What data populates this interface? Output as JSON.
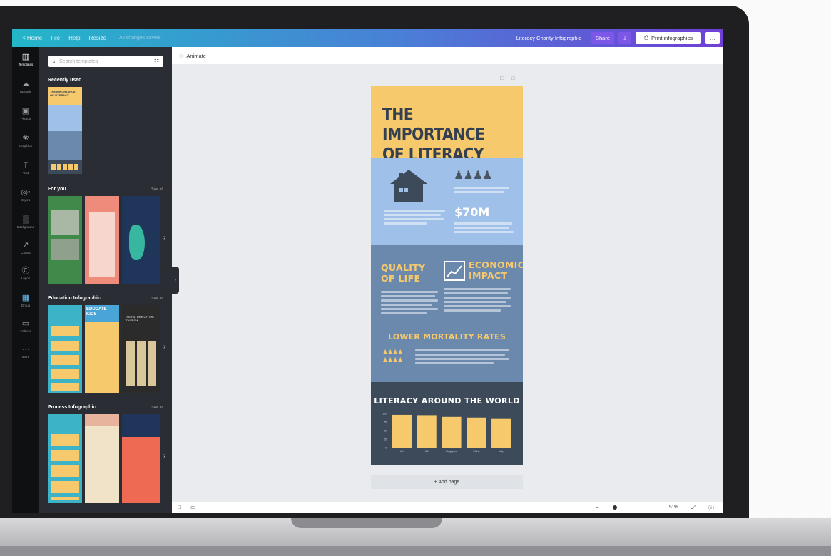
{
  "topbar": {
    "nav": [
      "< Home",
      "File",
      "Help",
      "Resize"
    ],
    "saved_status": "All changes saved",
    "doc_title": "Literacy Charity Infographic",
    "share_label": "Share",
    "download_icon": "download-icon",
    "print_label": "Print infographics",
    "print_icon": "printer-icon",
    "more_label": "…"
  },
  "rail": {
    "items": [
      {
        "label": "Templates",
        "icon": "template-icon"
      },
      {
        "label": "Uploads",
        "icon": "upload-icon"
      },
      {
        "label": "Photos",
        "icon": "photo-icon"
      },
      {
        "label": "Graphics",
        "icon": "graphics-icon"
      },
      {
        "label": "Text",
        "icon": "text-icon"
      },
      {
        "label": "Styles",
        "icon": "styles-icon"
      },
      {
        "label": "Background",
        "icon": "background-icon"
      },
      {
        "label": "Charts",
        "icon": "chart-icon"
      },
      {
        "label": "Logos",
        "icon": "logo-icon"
      },
      {
        "label": "Group",
        "icon": "group-icon"
      },
      {
        "label": "Folders",
        "icon": "folder-icon"
      },
      {
        "label": "More",
        "icon": "more-icon"
      }
    ]
  },
  "panel": {
    "search_placeholder": "Search templates",
    "sections": [
      {
        "title": "Recently used",
        "see_all": ""
      },
      {
        "title": "For you",
        "see_all": "See all"
      },
      {
        "title": "Education Infographic",
        "see_all": "See all"
      },
      {
        "title": "Process Infographic",
        "see_all": "See all"
      }
    ],
    "thumb_texts": {
      "recent_title": "THE IMPORTANCE OF LITERACY",
      "educate": "EDUCATE KIDS",
      "future": "THE FUTURE OF THE TOURISM"
    }
  },
  "canvas": {
    "animate_label": "Animate",
    "add_page_label": "+ Add page",
    "zoom_label": "51%"
  },
  "infographic": {
    "title": "THE IMPORTANCE OF LITERACY",
    "stat": "$70M",
    "quality": "QUALITY OF LIFE",
    "economic": "ECONOMIC IMPACT",
    "mortality": "LOWER MORTALITY RATES",
    "world": "LITERACY AROUND THE WORLD",
    "colors": {
      "yellow": "#f5c96c",
      "light_blue": "#9fc0e8",
      "mid_blue": "#6b88ad",
      "dark": "#3d4a5a"
    }
  },
  "chart_data": {
    "type": "bar",
    "title": "LITERACY AROUND THE WORLD",
    "categories": [
      "UK",
      "US",
      "Singapore",
      "China",
      "Italy"
    ],
    "values": [
      96,
      95,
      90,
      88,
      84
    ],
    "ylim": [
      0,
      100
    ],
    "yticks": [
      0,
      25,
      50,
      75,
      100
    ],
    "bar_color": "#f5c96c"
  }
}
